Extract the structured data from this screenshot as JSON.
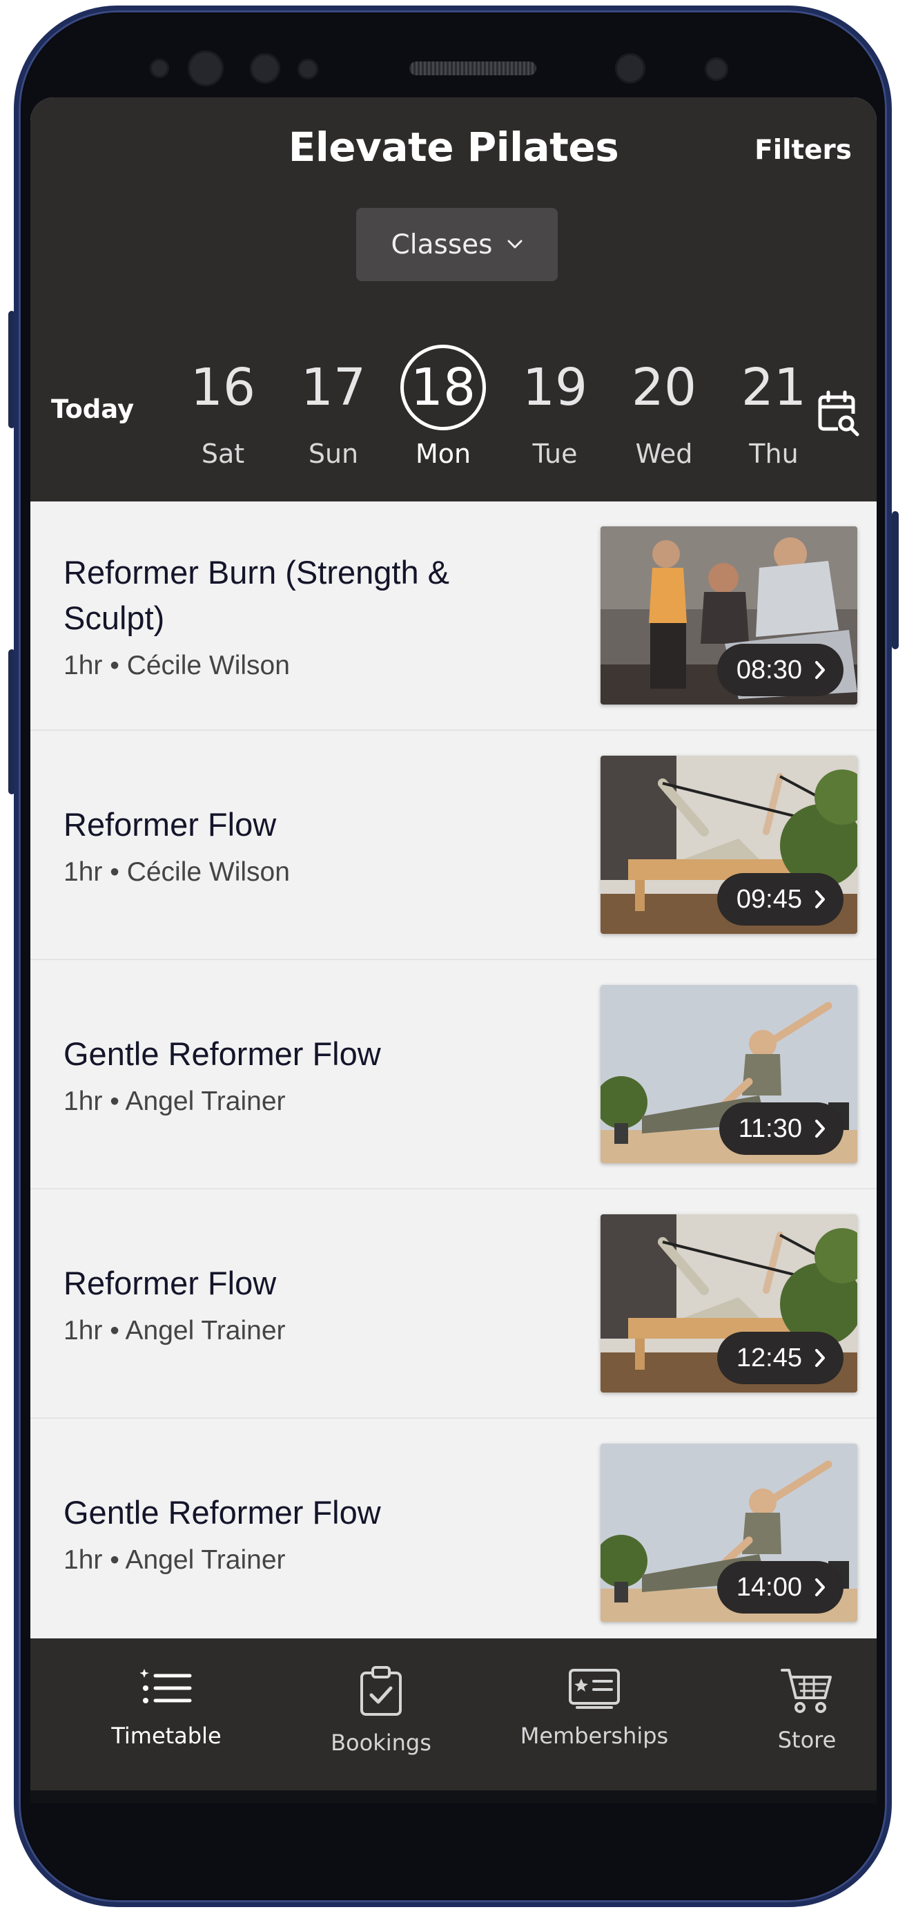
{
  "app": {
    "title": "Elevate Pilates",
    "filters_label": "Filters"
  },
  "category_dropdown": {
    "selected": "Classes"
  },
  "date_strip": {
    "today_label": "Today",
    "days": [
      {
        "num": "16",
        "weekday": "Sat"
      },
      {
        "num": "17",
        "weekday": "Sun"
      },
      {
        "num": "18",
        "weekday": "Mon",
        "selected": true
      },
      {
        "num": "19",
        "weekday": "Tue"
      },
      {
        "num": "20",
        "weekday": "Wed"
      },
      {
        "num": "21",
        "weekday": "Thu"
      }
    ]
  },
  "classes": [
    {
      "name": "Reformer Burn (Strength & Sculpt)",
      "meta": "1hr • Cécile Wilson",
      "time": "08:30",
      "image": "trainer-assisting-photo"
    },
    {
      "name": "Reformer Flow",
      "meta": "1hr • Cécile Wilson",
      "time": "09:45",
      "image": "reformer-straps-photo"
    },
    {
      "name": "Gentle Reformer Flow",
      "meta": "1hr • Angel Trainer",
      "time": "11:30",
      "image": "side-stretch-photo"
    },
    {
      "name": "Reformer Flow",
      "meta": "1hr • Angel Trainer",
      "time": "12:45",
      "image": "reformer-straps-photo"
    },
    {
      "name": "Gentle Reformer Flow",
      "meta": "1hr • Angel Trainer",
      "time": "14:00",
      "image": "side-stretch-photo"
    }
  ],
  "bottom_nav": [
    {
      "label": "Timetable",
      "icon": "list-icon",
      "active": true
    },
    {
      "label": "Bookings",
      "icon": "clipboard-check-icon"
    },
    {
      "label": "Memberships",
      "icon": "id-card-icon"
    },
    {
      "label": "Store",
      "icon": "cart-icon"
    }
  ],
  "colors": {
    "header_bg": "#2e2b2b",
    "list_bg": "#f2f2f2",
    "pill_bg": "#2b2929",
    "frame": "#1f2d5c"
  }
}
